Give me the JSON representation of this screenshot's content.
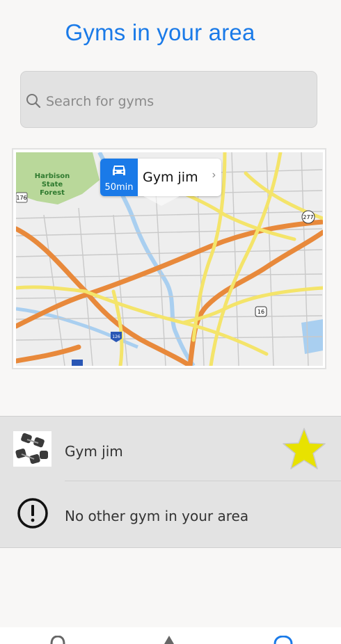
{
  "header": {
    "title": "Gyms in your area"
  },
  "search": {
    "placeholder": "Search for gyms",
    "icon": "search-icon"
  },
  "map": {
    "callout": {
      "travel_time": "50min",
      "name": "Gym jim",
      "icon": "car-icon"
    },
    "labels": {
      "forest": [
        "Harbison",
        "State",
        "Forest"
      ],
      "shields": [
        "176",
        "277",
        "16",
        "126"
      ]
    }
  },
  "results": {
    "items": [
      {
        "name": "Gym jim",
        "icon": "dumbbell-thumbnail",
        "favorite_icon": "star-icon"
      },
      {
        "message": "No other gym in your area",
        "icon": "alert-icon"
      }
    ]
  },
  "colors": {
    "accent": "#1a7ae8",
    "star": "#e8e200",
    "list_bg": "#e3e3e3"
  }
}
